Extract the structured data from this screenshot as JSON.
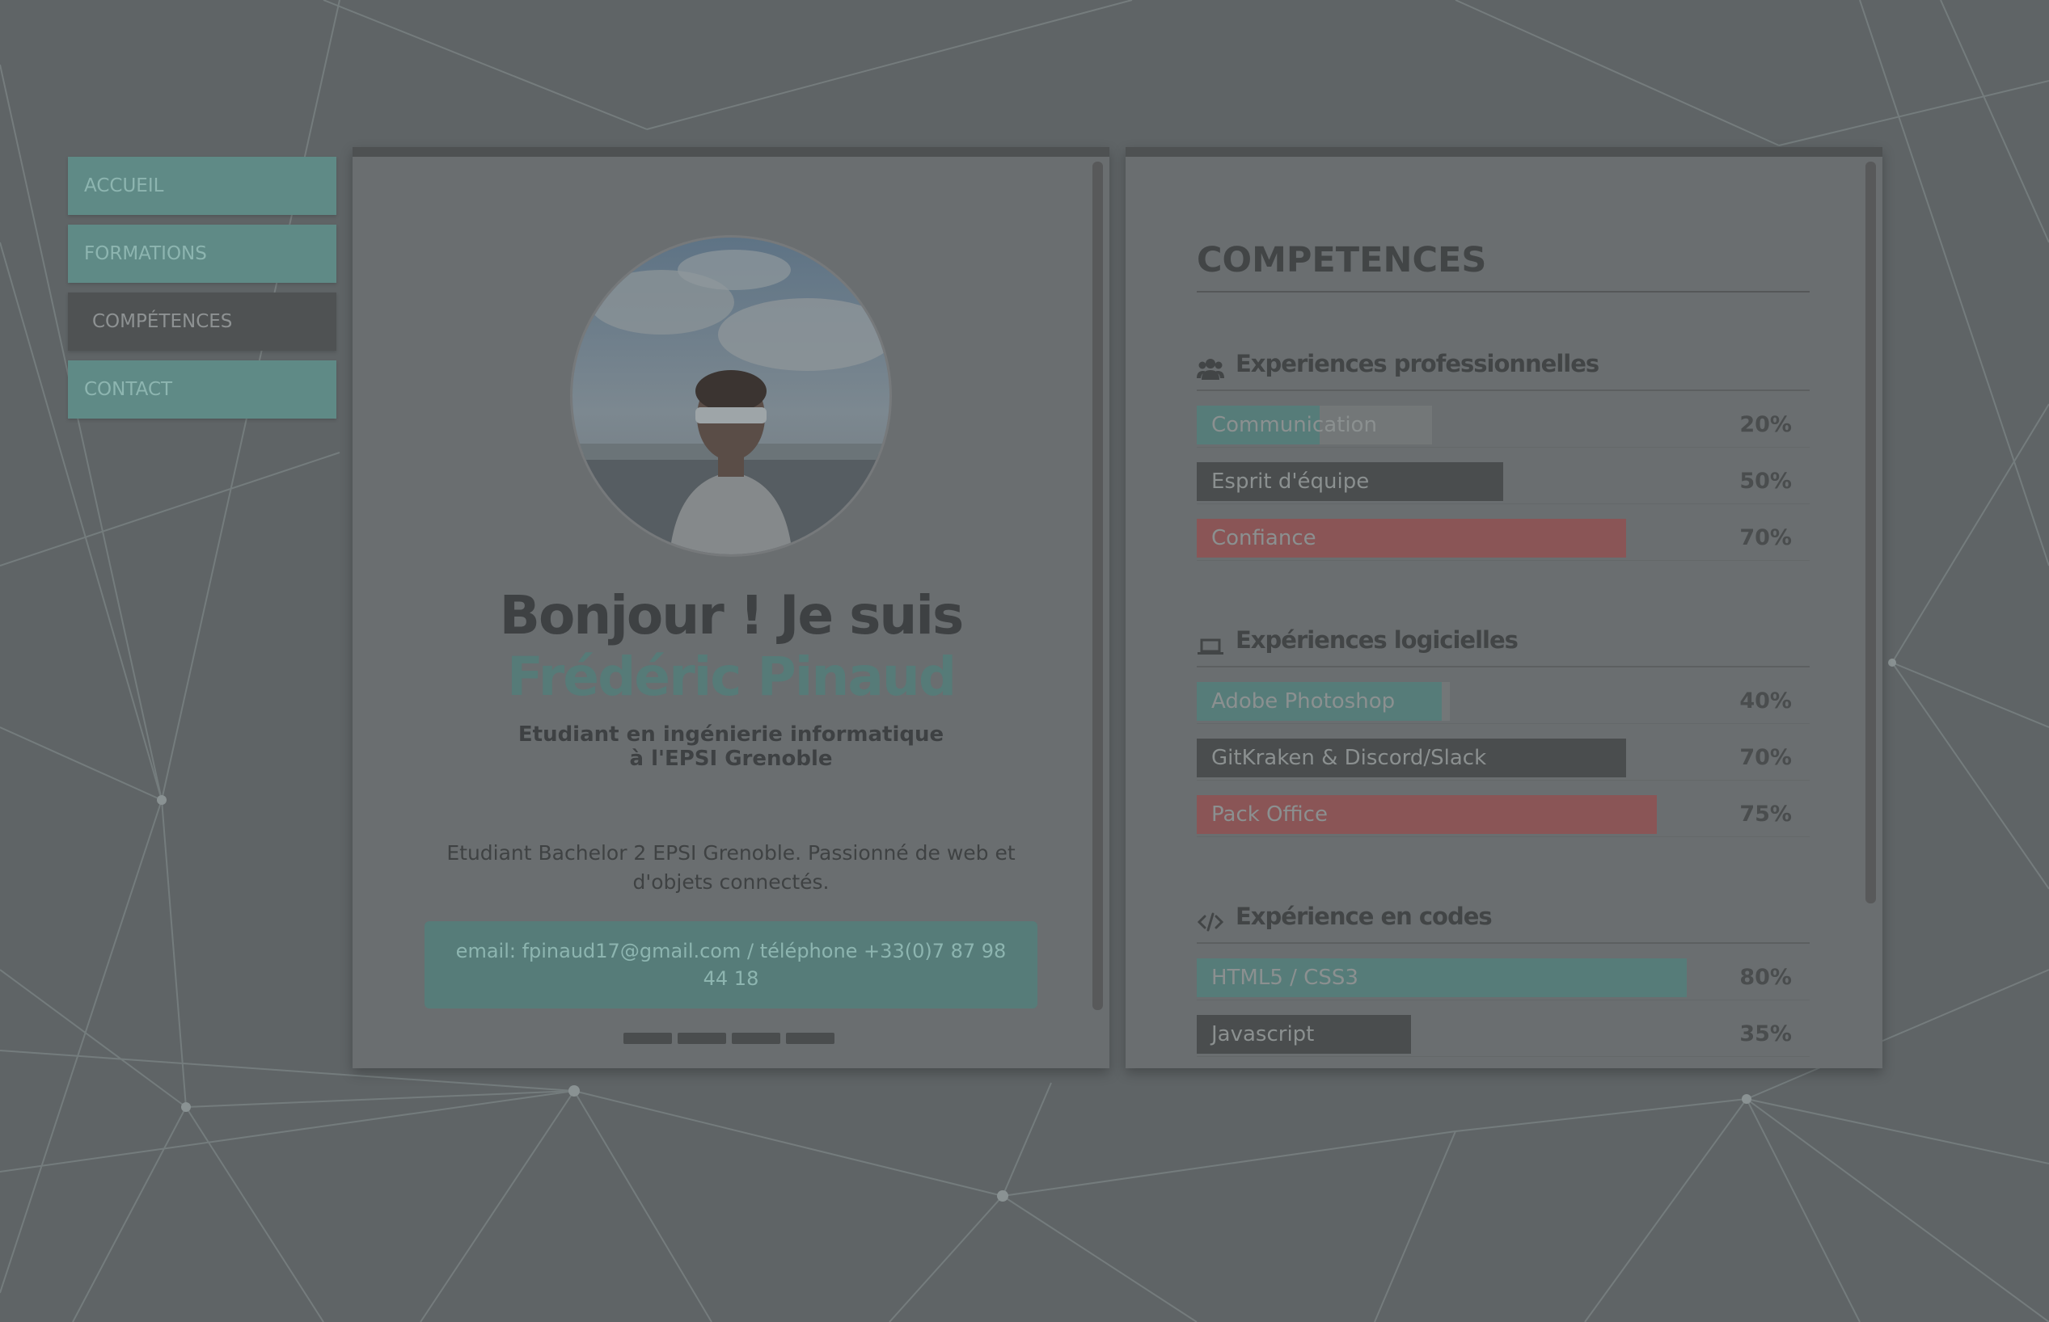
{
  "nav": {
    "items": [
      {
        "label": "ACCUEIL",
        "active": false
      },
      {
        "label": "FORMATIONS",
        "active": false
      },
      {
        "label": "COMPÉTENCES",
        "active": true
      },
      {
        "label": "CONTACT",
        "active": false
      }
    ]
  },
  "profile": {
    "greeting": "Bonjour ! Je suis",
    "name": "Frédéric Pinaud",
    "subtitle_line1": "Etudiant en ingénierie informatique",
    "subtitle_line2": "à l'EPSI Grenoble",
    "description": "Etudiant Bachelor 2 EPSI Grenoble. Passionné de web et d'objets connectés.",
    "contact": "email: fpinaud17@gmail.com / téléphone +33(0)7 87 98 44 18",
    "slider_dots": 4
  },
  "skills": {
    "title": "COMPETENCES",
    "sections": [
      {
        "title": "Experiences professionnelles",
        "icon": "users-icon",
        "items": [
          {
            "label": "Communication",
            "value": 20,
            "percent": "20%",
            "color": "teal"
          },
          {
            "label": "Esprit d'équipe",
            "value": 50,
            "percent": "50%",
            "color": "dark"
          },
          {
            "label": "Confiance",
            "value": 70,
            "percent": "70%",
            "color": "red"
          }
        ]
      },
      {
        "title": "Expériences logicielles",
        "icon": "laptop-icon",
        "items": [
          {
            "label": "Adobe Photoshop",
            "value": 40,
            "percent": "40%",
            "color": "teal"
          },
          {
            "label": "GitKraken & Discord/Slack",
            "value": 70,
            "percent": "70%",
            "color": "dark"
          },
          {
            "label": "Pack Office",
            "value": 75,
            "percent": "75%",
            "color": "red"
          }
        ]
      },
      {
        "title": "Expérience en codes",
        "icon": "code-icon",
        "items": [
          {
            "label": "HTML5 / CSS3",
            "value": 80,
            "percent": "80%",
            "color": "teal"
          },
          {
            "label": "Javascript",
            "value": 35,
            "percent": "35%",
            "color": "dark"
          }
        ]
      }
    ]
  },
  "colors": {
    "overlay": "#5f6466",
    "teal": "#567c79",
    "dark": "#4a4d4e",
    "red": "#8a5556"
  }
}
